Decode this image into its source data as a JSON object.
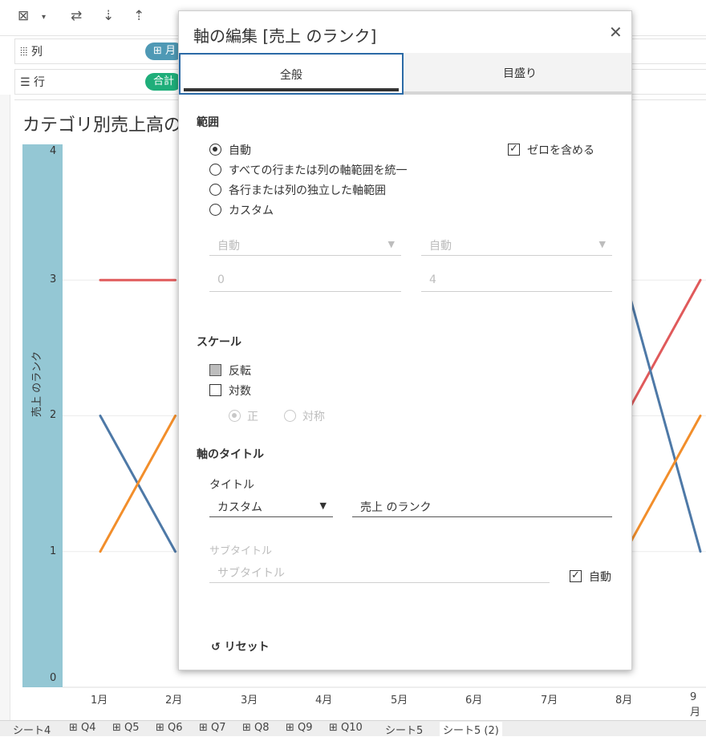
{
  "toolbar": {
    "icons": [
      "table-close-icon",
      "dropdown-icon",
      "swap-icon",
      "sort-ascending-icon",
      "sort-descending-icon"
    ]
  },
  "shelves": {
    "columns": {
      "label": "列",
      "pill": "月"
    },
    "rows": {
      "label": "行",
      "pill": "合計"
    }
  },
  "viz": {
    "title": "カテゴリ別売上高の",
    "y_axis_title": "売上 のランク",
    "y_ticks": [
      "4",
      "3",
      "2",
      "1",
      "0"
    ],
    "x_ticks": [
      "1月",
      "2月",
      "3月",
      "4月",
      "5月",
      "6月",
      "7月",
      "8月",
      "9月"
    ],
    "band_color": "#94c7d4"
  },
  "chart_data": {
    "type": "line",
    "categories": [
      "1月",
      "2月",
      "3月",
      "4月",
      "5月",
      "6月",
      "7月",
      "8月",
      "9月"
    ],
    "ylim": [
      0,
      4
    ],
    "ylabel": "売上 のランク",
    "series": [
      {
        "color": "#e05a5b",
        "values": [
          3,
          3,
          null,
          null,
          null,
          null,
          null,
          2,
          3
        ]
      },
      {
        "color": "#4e79a7",
        "values": [
          2,
          1,
          null,
          null,
          null,
          null,
          null,
          3,
          1
        ]
      },
      {
        "color": "#f28e2b",
        "values": [
          1,
          2,
          null,
          null,
          null,
          null,
          null,
          1,
          2
        ]
      }
    ]
  },
  "bottom_tabs": [
    "シート4",
    "Q4",
    "Q5",
    "Q6",
    "Q7",
    "Q8",
    "Q9",
    "Q10",
    "シート5",
    "シート5 (2)"
  ],
  "dialog": {
    "title": "軸の編集 [売上 のランク]",
    "tabs": {
      "general": "全般",
      "ticks": "目盛り"
    },
    "range": {
      "section": "範囲",
      "options": [
        "自動",
        "すべての行または列の軸範囲を統一",
        "各行または列の独立した軸範囲",
        "カスタム"
      ],
      "include_zero": "ゼロを含める",
      "start_select": "自動",
      "end_select": "自動",
      "start_value": "0",
      "end_value": "4"
    },
    "scale": {
      "section": "スケール",
      "reversed": "反転",
      "logarithmic": "対数",
      "positive": "正",
      "symmetric": "対称"
    },
    "axis_title": {
      "section": "軸のタイトル",
      "title_label": "タイトル",
      "title_mode": "カスタム",
      "title_value": "売上 のランク",
      "subtitle_label": "サブタイトル",
      "subtitle_placeholder": "サブタイトル",
      "auto": "自動"
    },
    "reset": "リセット"
  }
}
